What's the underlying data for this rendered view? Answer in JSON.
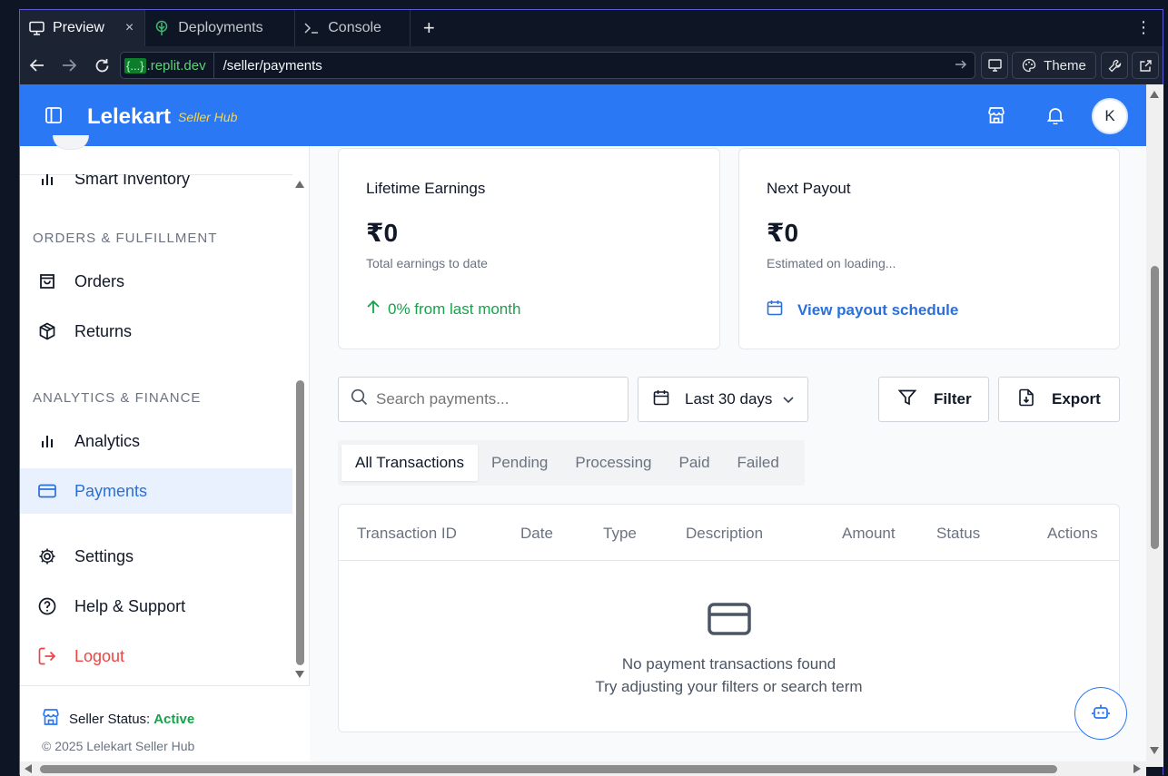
{
  "browser": {
    "tabs": [
      {
        "label": "Preview",
        "icon": "monitor-icon",
        "active": true
      },
      {
        "label": "Deployments",
        "icon": "deploy-tree-icon",
        "active": false
      },
      {
        "label": "Console",
        "icon": "terminal-prompt-icon",
        "active": false
      }
    ],
    "close_glyph": "×",
    "new_tab_glyph": "+",
    "menu_glyph": "⋮",
    "url_host_brace": "{...}",
    "url_host": ".replit.dev",
    "url_path": "/seller/payments",
    "theme_label": "Theme"
  },
  "header": {
    "brand": "Lelekart",
    "brand_sub": "Seller Hub",
    "avatar_initial": "K",
    "colors": {
      "bar": "#2b78f4",
      "brand_sub": "#ffd43b"
    }
  },
  "sidebar": {
    "partial_item": "Smart Inventory",
    "sections": {
      "orders": "ORDERS & FULFILLMENT",
      "analytics": "ANALYTICS & FINANCE"
    },
    "items": [
      {
        "label": "Orders",
        "icon": "shopping-bag-icon"
      },
      {
        "label": "Returns",
        "icon": "package-icon"
      },
      {
        "label": "Analytics",
        "icon": "bar-chart-icon"
      },
      {
        "label": "Payments",
        "icon": "credit-card-icon",
        "active": true
      },
      {
        "label": "Settings",
        "icon": "gear-icon"
      },
      {
        "label": "Help & Support",
        "icon": "help-circle-icon"
      },
      {
        "label": "Logout",
        "icon": "logout-icon"
      }
    ],
    "seller_status_label": "Seller Status:",
    "seller_status_value": "Active",
    "copyright": "© 2025 Lelekart Seller Hub"
  },
  "cards": {
    "lifetime": {
      "title": "Lifetime Earnings",
      "value": "₹0",
      "sub": "Total earnings to date",
      "foot": "0% from last month"
    },
    "payout": {
      "title": "Next Payout",
      "value": "₹0",
      "sub": "Estimated on loading...",
      "foot": "View payout schedule"
    }
  },
  "controls": {
    "search_placeholder": "Search payments...",
    "date_range": "Last 30 days",
    "filter_label": "Filter",
    "export_label": "Export"
  },
  "tabs": [
    "All Transactions",
    "Pending",
    "Processing",
    "Paid",
    "Failed"
  ],
  "table": {
    "columns": [
      "Transaction ID",
      "Date",
      "Type",
      "Description",
      "Amount",
      "Status",
      "Actions"
    ],
    "rows": [],
    "empty_title": "No payment transactions found",
    "empty_hint": "Try adjusting your filters or search term"
  }
}
